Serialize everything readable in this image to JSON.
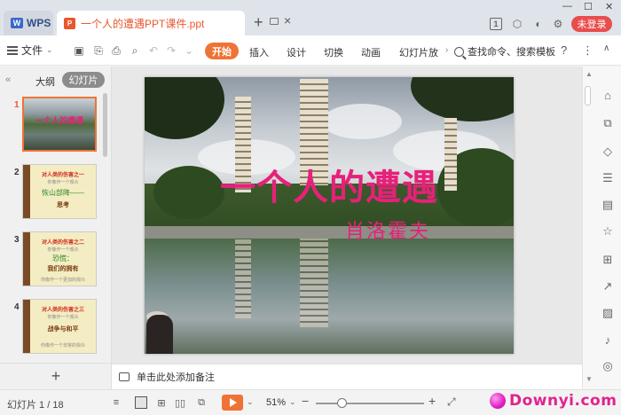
{
  "titlebar": {
    "app_name": "WPS",
    "doc_title": "一个人的遭遇PPT课件.ppt",
    "login_label": "未登录",
    "badge_num": "1"
  },
  "toolbar": {
    "file_label": "文件",
    "start_label": "开始",
    "tabs": [
      "插入",
      "设计",
      "切换",
      "动画",
      "幻灯片放"
    ],
    "search_label": "查找命令、搜索模板",
    "help_label": "?",
    "more_label": "⋮"
  },
  "left_panel": {
    "outline_tab": "大纲",
    "slides_tab": "幻灯片",
    "slides": [
      {
        "num": "1",
        "title": "一个人的遭遇"
      },
      {
        "num": "2",
        "lines": [
          "对人类的伤害之一",
          "你像作一个观众",
          "恢山部降——",
          "思考"
        ]
      },
      {
        "num": "3",
        "lines": [
          "对人类的伤害之二",
          "你像作一个观众",
          "恐慌：",
          "我们的拥有",
          "你像作一个更加的观众"
        ]
      },
      {
        "num": "4",
        "lines": [
          "对人类的伤害之三",
          "你像作一个观众",
          "战争与和平",
          "你像作一个非常的观众"
        ]
      }
    ],
    "add_slide": "+"
  },
  "slide": {
    "title": "一个人的遭遇",
    "subtitle": "肖洛霍夫"
  },
  "notes": {
    "placeholder": "单击此处添加备注"
  },
  "statusbar": {
    "slide_counter": "幻灯片 1 / 18",
    "zoom": "51%",
    "watermark": "Downyi.com"
  },
  "colors": {
    "accent_orange": "#ef7334",
    "title_pink": "#e6217a",
    "login_red": "#e94d4d"
  }
}
